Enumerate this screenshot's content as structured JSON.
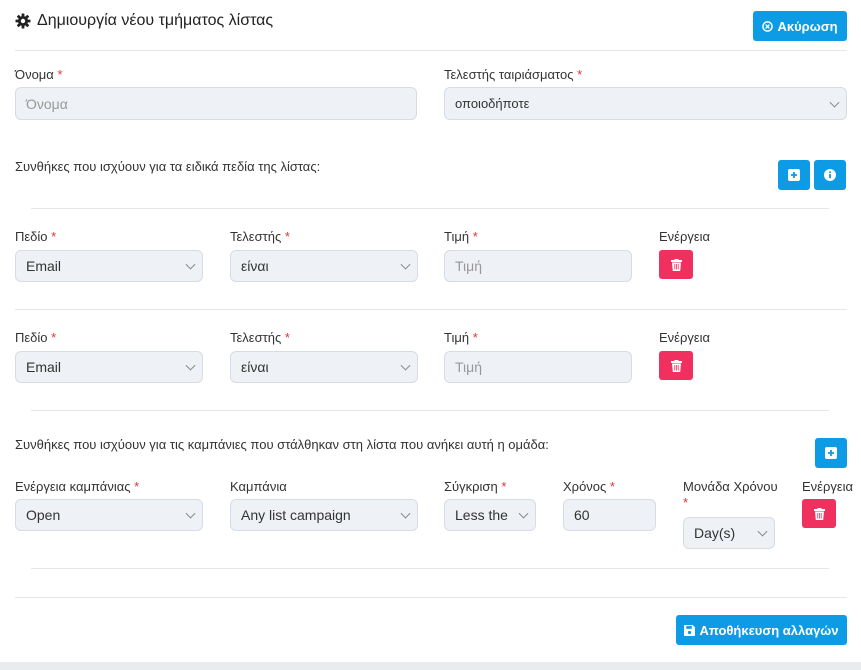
{
  "header": {
    "title": "Δημιουργία νέου τμήματος λίστας",
    "cancel_label": "Ακύρωση",
    "icon": "gear-icon"
  },
  "name_field": {
    "label": "Όνομα",
    "required": "*",
    "placeholder": "Όνομα"
  },
  "match_field": {
    "label": "Τελεστής ταιριάσματος",
    "required": "*",
    "value": "οποιοδήποτε"
  },
  "field_conditions": {
    "heading": "Συνθήκες που ισχύουν για τα ειδικά πεδία της λίστας:",
    "rows": [
      {
        "field_label": "Πεδίο",
        "field_value": "Email",
        "operator_label": "Τελεστής",
        "operator_value": "είναι",
        "value_label": "Τιμή",
        "value_placeholder": "Τιμή",
        "action_label": "Ενέργεια",
        "required": "*"
      },
      {
        "field_label": "Πεδίο",
        "field_value": "Email",
        "operator_label": "Τελεστής",
        "operator_value": "είναι",
        "value_label": "Τιμή",
        "value_placeholder": "Τιμή",
        "action_label": "Ενέργεια",
        "required": "*"
      }
    ]
  },
  "campaign_conditions": {
    "heading": "Συνθήκες που ισχύουν για τις καμπάνιες που στάλθηκαν στη λίστα που ανήκει αυτή η ομάδα:",
    "row": {
      "action_label": "Ενέργεια καμπάνιας",
      "action_value": "Open",
      "campaign_label": "Καμπάνια",
      "campaign_value": "Any list campaign",
      "compare_label": "Σύγκριση",
      "compare_value": "Less the",
      "time_label": "Χρόνος",
      "time_value": "60",
      "unit_label": "Μονάδα Χρόνου",
      "unit_value": "Day(s)",
      "remove_label": "Ενέργεια",
      "required": "*"
    }
  },
  "footer": {
    "save_label": "Αποθήκευση αλλαγών"
  },
  "colors": {
    "primary": "#0d9be6",
    "danger": "#f0305e",
    "required": "#e3342f"
  }
}
